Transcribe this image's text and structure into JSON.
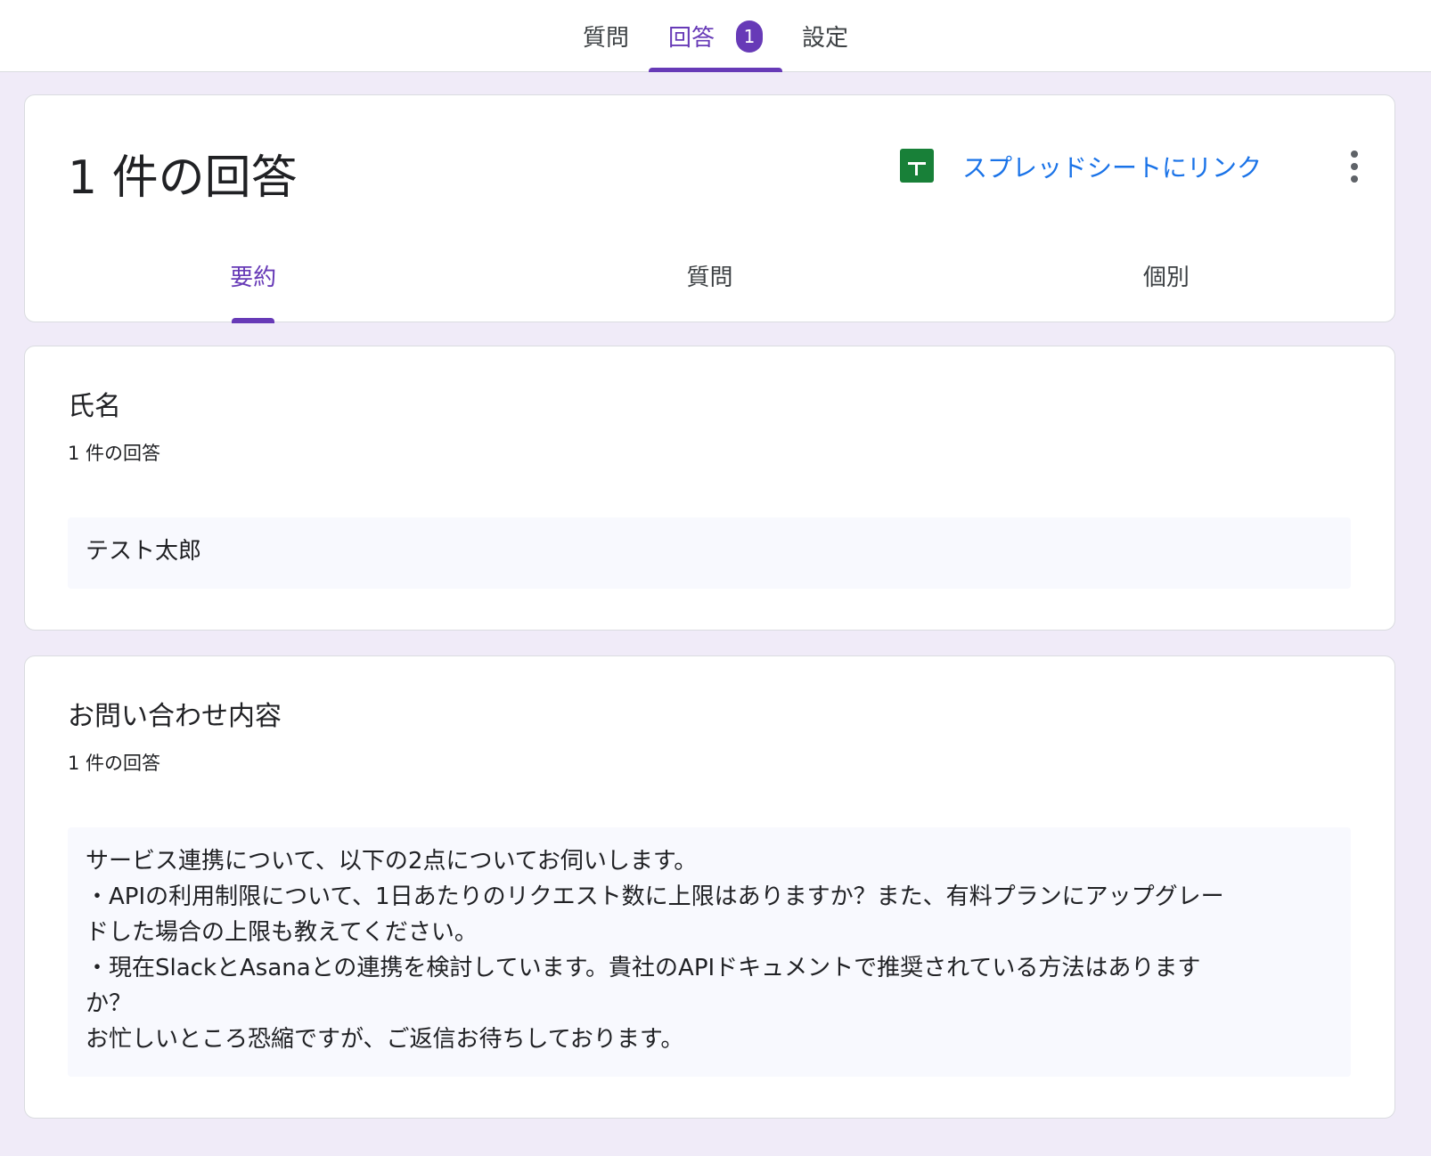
{
  "top_tabs": [
    {
      "label": "質問"
    },
    {
      "label": "回答",
      "badge": "1"
    },
    {
      "label": "設定"
    }
  ],
  "header": {
    "title": "1 件の回答",
    "sheet_link": "スプレッドシートにリンク",
    "sub_tabs": [
      {
        "label": "要約"
      },
      {
        "label": "質問"
      },
      {
        "label": "個別"
      }
    ]
  },
  "questions": [
    {
      "title": "氏名",
      "count": "1 件の回答",
      "answer_lines": [
        "テスト太郎"
      ]
    },
    {
      "title": "お問い合わせ内容",
      "count": "1 件の回答",
      "answer_lines": [
        "サービス連携について、以下の2点についてお伺いします。",
        "・APIの利用制限について、1日あたりのリクエスト数に上限はありますか？また、有料プランにアップグレー",
        "ドした場合の上限も教えてください。",
        "・現在SlackとAsanaとの連携を検討しています。貴社のAPIドキュメントで推奨されている方法はあります",
        "か？",
        "お忙しいところ恐縮ですが、ご返信お待ちしております。"
      ]
    }
  ],
  "colors": {
    "accent": "#673ab7",
    "link": "#1a73e8",
    "sheets": "#188038",
    "background": "#f0ebf8"
  }
}
